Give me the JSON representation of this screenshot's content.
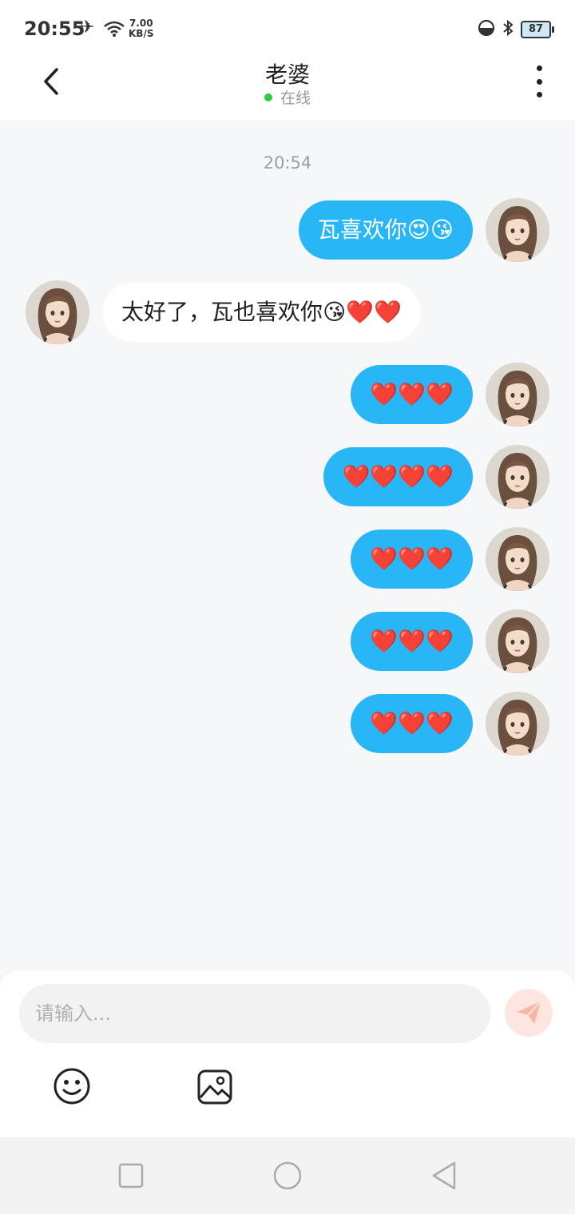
{
  "status_bar": {
    "time": "20:55",
    "speed_value": "7.00",
    "speed_unit": "KB/S",
    "battery": "87"
  },
  "header": {
    "title": "老婆",
    "status": "在线",
    "status_color": "#2ecc40"
  },
  "timestamp": "20:54",
  "messages": [
    {
      "direction": "out",
      "text": "瓦喜欢你😍😘"
    },
    {
      "direction": "in",
      "text": "太好了，瓦也喜欢你😘❤️❤️"
    },
    {
      "direction": "out",
      "text": "❤️❤️❤️"
    },
    {
      "direction": "out",
      "text": "❤️❤️❤️❤️"
    },
    {
      "direction": "out",
      "text": "❤️❤️❤️"
    },
    {
      "direction": "out",
      "text": "❤️❤️❤️"
    },
    {
      "direction": "out",
      "text": "❤️❤️❤️"
    }
  ],
  "composer": {
    "placeholder": "请输入...",
    "value": ""
  },
  "colors": {
    "outgoing_bubble": "#28b6f6",
    "incoming_bubble": "#ffffff",
    "background": "#f5f7f8",
    "send_button": "#fde6e0"
  },
  "icons": {
    "back": "chevron-left-icon",
    "more": "more-vertical-icon",
    "send": "paper-plane-icon",
    "emoji": "smiley-icon",
    "image": "image-icon",
    "nav_recent": "square-icon",
    "nav_home": "circle-icon",
    "nav_back": "triangle-back-icon"
  }
}
